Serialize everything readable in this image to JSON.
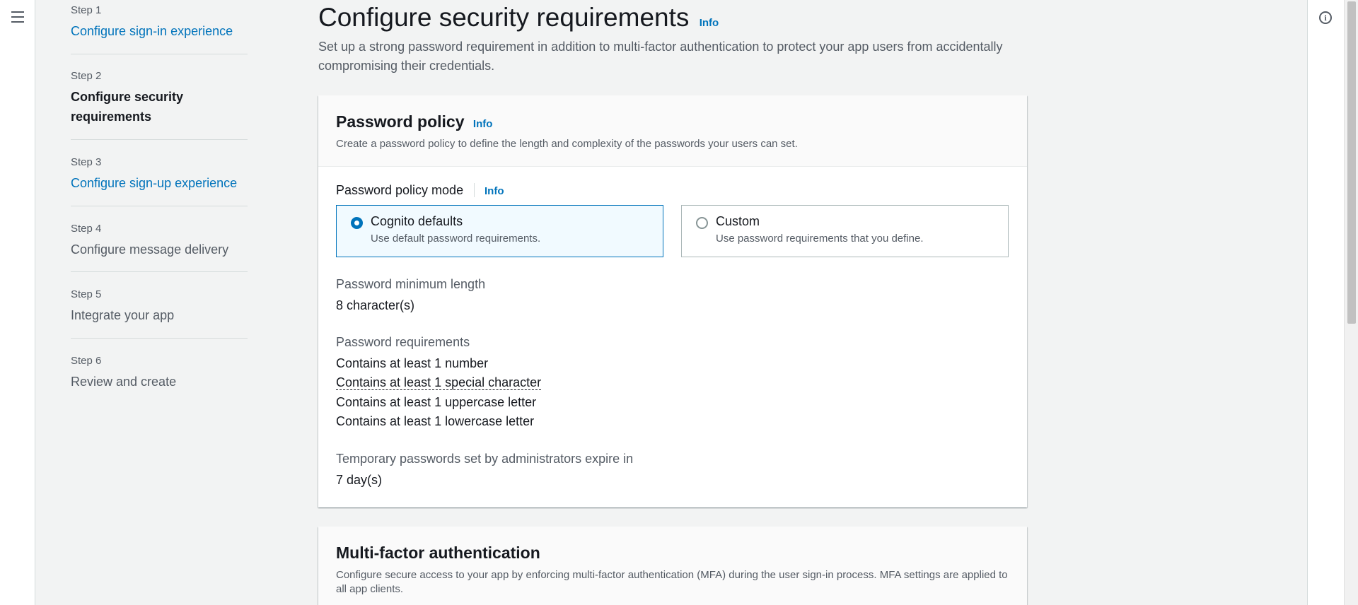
{
  "nav": {
    "menu_icon": "hamburger-icon",
    "help_icon": "info-circle-icon"
  },
  "steps": [
    {
      "num": "Step 1",
      "title": "Configure sign-in experience",
      "state": "link"
    },
    {
      "num": "Step 2",
      "title": "Configure security requirements",
      "state": "current"
    },
    {
      "num": "Step 3",
      "title": "Configure sign-up experience",
      "state": "link"
    },
    {
      "num": "Step 4",
      "title": "Configure message delivery",
      "state": "disabled"
    },
    {
      "num": "Step 5",
      "title": "Integrate your app",
      "state": "disabled"
    },
    {
      "num": "Step 6",
      "title": "Review and create",
      "state": "disabled"
    }
  ],
  "page": {
    "title": "Configure security requirements",
    "info": "Info",
    "description": "Set up a strong password requirement in addition to multi-factor authentication to protect your app users from accidentally compromising their credentials."
  },
  "password_policy": {
    "title": "Password policy",
    "info": "Info",
    "description": "Create a password policy to define the length and complexity of the passwords your users can set.",
    "mode_label": "Password policy mode",
    "mode_info": "Info",
    "options": [
      {
        "title": "Cognito defaults",
        "desc": "Use default password requirements.",
        "selected": true
      },
      {
        "title": "Custom",
        "desc": "Use password requirements that you define.",
        "selected": false
      }
    ],
    "min_length_label": "Password minimum length",
    "min_length_value": "8 character(s)",
    "requirements_label": "Password requirements",
    "requirements": [
      "Contains at least 1 number",
      "Contains at least 1 special character",
      "Contains at least 1 uppercase letter",
      "Contains at least 1 lowercase letter"
    ],
    "temp_expiry_label": "Temporary passwords set by administrators expire in",
    "temp_expiry_value": "7 day(s)"
  },
  "mfa": {
    "title": "Multi-factor authentication",
    "description": "Configure secure access to your app by enforcing multi-factor authentication (MFA) during the user sign-in process. MFA settings are applied to all app clients."
  },
  "colors": {
    "link": "#0073bb",
    "selected_bg": "#f1faff",
    "page_bg": "#f2f3f3"
  }
}
